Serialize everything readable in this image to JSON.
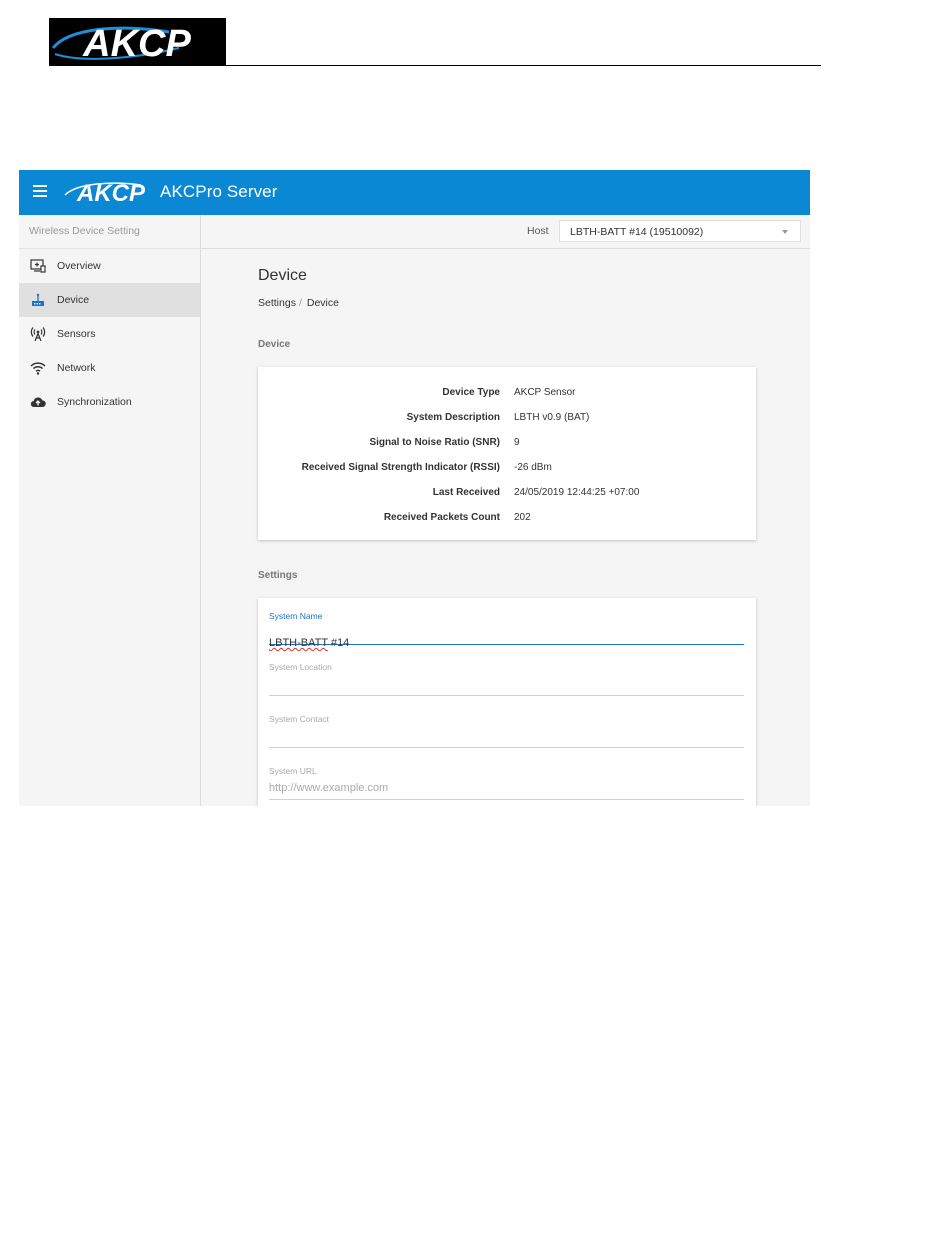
{
  "document": {
    "logo_text": "AKCP"
  },
  "app": {
    "logo_text": "AKCP",
    "title": "AKCPro Server"
  },
  "sidebar": {
    "header": "Wireless Device Setting",
    "items": [
      {
        "label": "Overview",
        "icon": "overview-icon",
        "active": false
      },
      {
        "label": "Device",
        "icon": "device-router-icon",
        "active": true
      },
      {
        "label": "Sensors",
        "icon": "antenna-icon",
        "active": false
      },
      {
        "label": "Network",
        "icon": "wifi-icon",
        "active": false
      },
      {
        "label": "Synchronization",
        "icon": "cloud-upload-icon",
        "active": false
      }
    ]
  },
  "host": {
    "label": "Host",
    "selected": "LBTH-BATT #14 (19510092)"
  },
  "page": {
    "title": "Device",
    "breadcrumb": [
      "Settings",
      "Device"
    ],
    "breadcrumb_sep": "/"
  },
  "device_section": {
    "title": "Device",
    "rows": [
      {
        "label": "Device Type",
        "value": "AKCP Sensor"
      },
      {
        "label": "System Description",
        "value": "LBTH v0.9 (BAT)"
      },
      {
        "label": "Signal to Noise Ratio (SNR)",
        "value": "9"
      },
      {
        "label": "Received Signal Strength Indicator (RSSI)",
        "value": "-26 dBm"
      },
      {
        "label": "Last Received",
        "value": "24/05/2019 12:44:25 +07:00"
      },
      {
        "label": "Received Packets Count",
        "value": "202"
      }
    ]
  },
  "settings_section": {
    "title": "Settings",
    "fields": [
      {
        "label": "System Name",
        "value_main": "LBTH-BATT",
        "value_rest": " #14",
        "placeholder": ""
      },
      {
        "label": "System Location",
        "value": "",
        "placeholder": ""
      },
      {
        "label": "System Contact",
        "value": "",
        "placeholder": ""
      },
      {
        "label": "System URL",
        "value": "",
        "placeholder": "http://www.example.com"
      }
    ]
  },
  "colors": {
    "appbar": "#0a88d4",
    "focus": "#1a73c9",
    "active_item": "#e0e0e0"
  }
}
